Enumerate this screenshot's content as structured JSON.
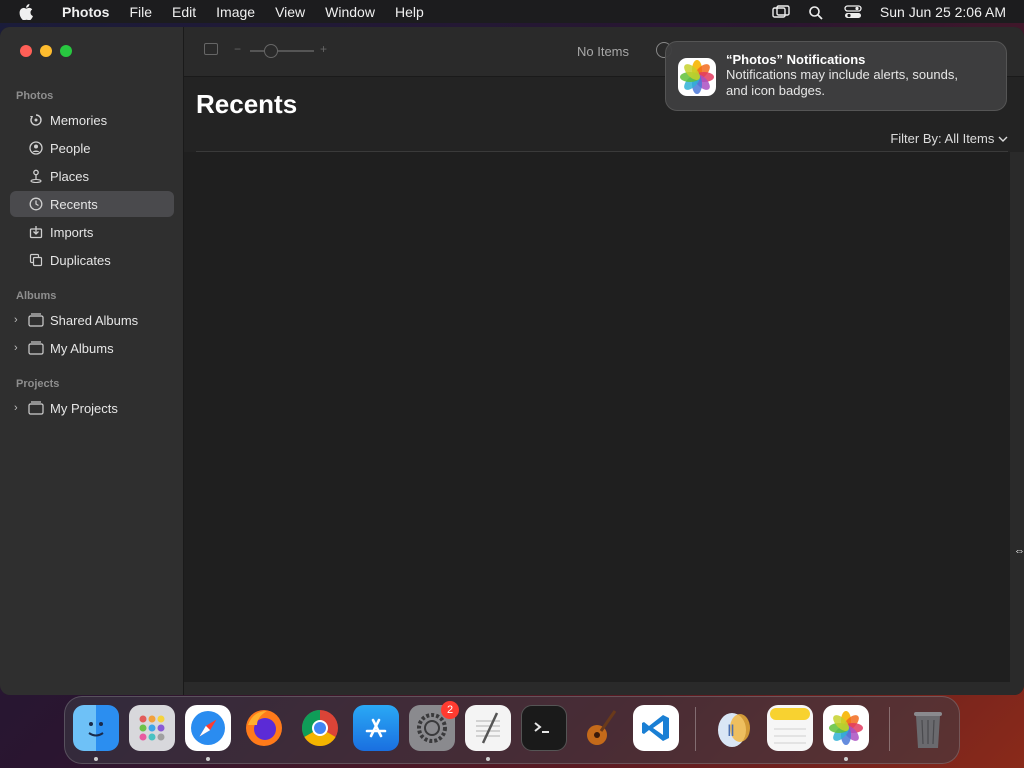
{
  "menubar": {
    "app_name": "Photos",
    "menus": [
      "File",
      "Edit",
      "Image",
      "View",
      "Window",
      "Help"
    ],
    "clock": "Sun Jun 25  2:06 AM",
    "status_icons": [
      "screen-mirroring-icon",
      "search-icon",
      "control-center-icon"
    ]
  },
  "sidebar": {
    "section_photos": "Photos",
    "photos_items": [
      {
        "label": "Memories",
        "icon": "memories-icon"
      },
      {
        "label": "People",
        "icon": "people-icon"
      },
      {
        "label": "Places",
        "icon": "places-icon"
      },
      {
        "label": "Recents",
        "icon": "recents-icon",
        "active": true
      },
      {
        "label": "Imports",
        "icon": "imports-icon"
      },
      {
        "label": "Duplicates",
        "icon": "duplicates-icon"
      }
    ],
    "section_albums": "Albums",
    "albums_items": [
      {
        "label": "Shared Albums",
        "icon": "shared-albums-icon"
      },
      {
        "label": "My Albums",
        "icon": "folder-icon"
      }
    ],
    "section_projects": "Projects",
    "projects_items": [
      {
        "label": "My Projects",
        "icon": "folder-icon"
      }
    ]
  },
  "toolbar": {
    "status": "No Items"
  },
  "main": {
    "title": "Recents",
    "filter_label": "Filter By: All Items"
  },
  "notification": {
    "title": "“Photos” Notifications",
    "body_line1": "Notifications may include alerts, sounds,",
    "body_line2": "and icon badges."
  },
  "dock": {
    "apps": [
      "Finder",
      "Launchpad",
      "Safari",
      "Firefox",
      "Chrome",
      "App Store",
      "System Settings",
      "TextEdit",
      "Terminal",
      "GarageBand",
      "Visual Studio Code",
      "Preview",
      "Notes",
      "Photos",
      "Trash"
    ],
    "settings_badge": "2"
  },
  "colors": {
    "accent_active": "#4a4a4d",
    "close": "#ff5f57",
    "minimize": "#febc2e",
    "maximize": "#28c840",
    "badge": "#ff3b30"
  }
}
